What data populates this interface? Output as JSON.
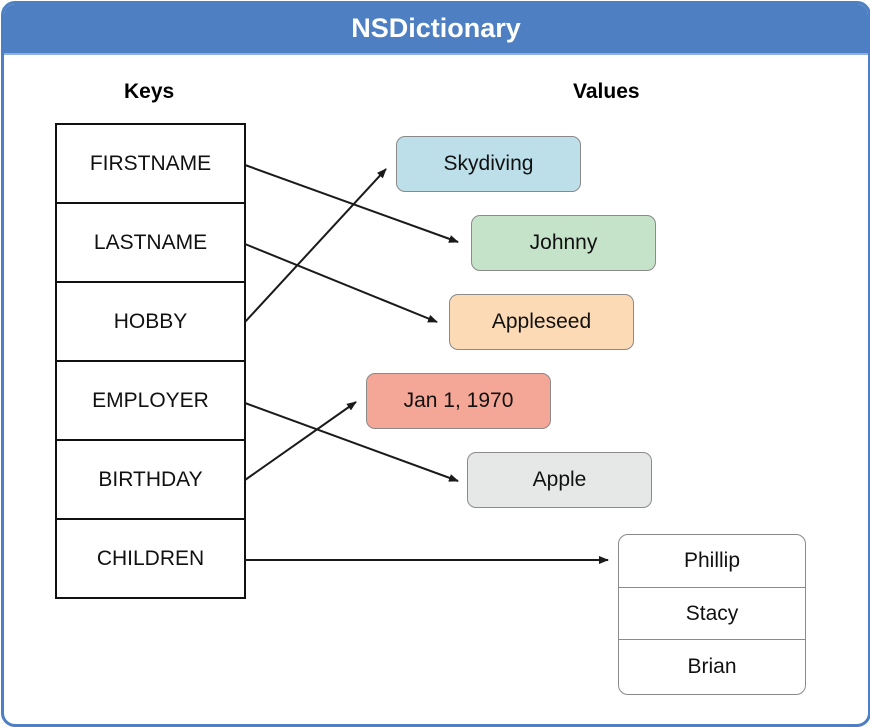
{
  "title": "NSDictionary",
  "columns": {
    "keys_label": "Keys",
    "values_label": "Values"
  },
  "keys": [
    {
      "label": "FIRSTNAME"
    },
    {
      "label": "LASTNAME"
    },
    {
      "label": "HOBBY"
    },
    {
      "label": "EMPLOYER"
    },
    {
      "label": "BIRTHDAY"
    },
    {
      "label": "CHILDREN"
    }
  ],
  "values": [
    {
      "label": "Skydiving",
      "color": "#bcdfea",
      "key": "HOBBY"
    },
    {
      "label": "Johnny",
      "color": "#c5e3c8",
      "key": "FIRSTNAME"
    },
    {
      "label": "Appleseed",
      "color": "#fcdab6",
      "key": "LASTNAME"
    },
    {
      "label": "Jan 1, 1970",
      "color": "#f4a797",
      "key": "BIRTHDAY"
    },
    {
      "label": "Apple",
      "color": "#e6e7e7",
      "key": "EMPLOYER"
    }
  ],
  "children": {
    "key": "CHILDREN",
    "items": [
      "Phillip",
      "Stacy",
      "Brian"
    ]
  },
  "colors": {
    "header": "#4d7fc2",
    "arrow": "#1a1a1a"
  }
}
